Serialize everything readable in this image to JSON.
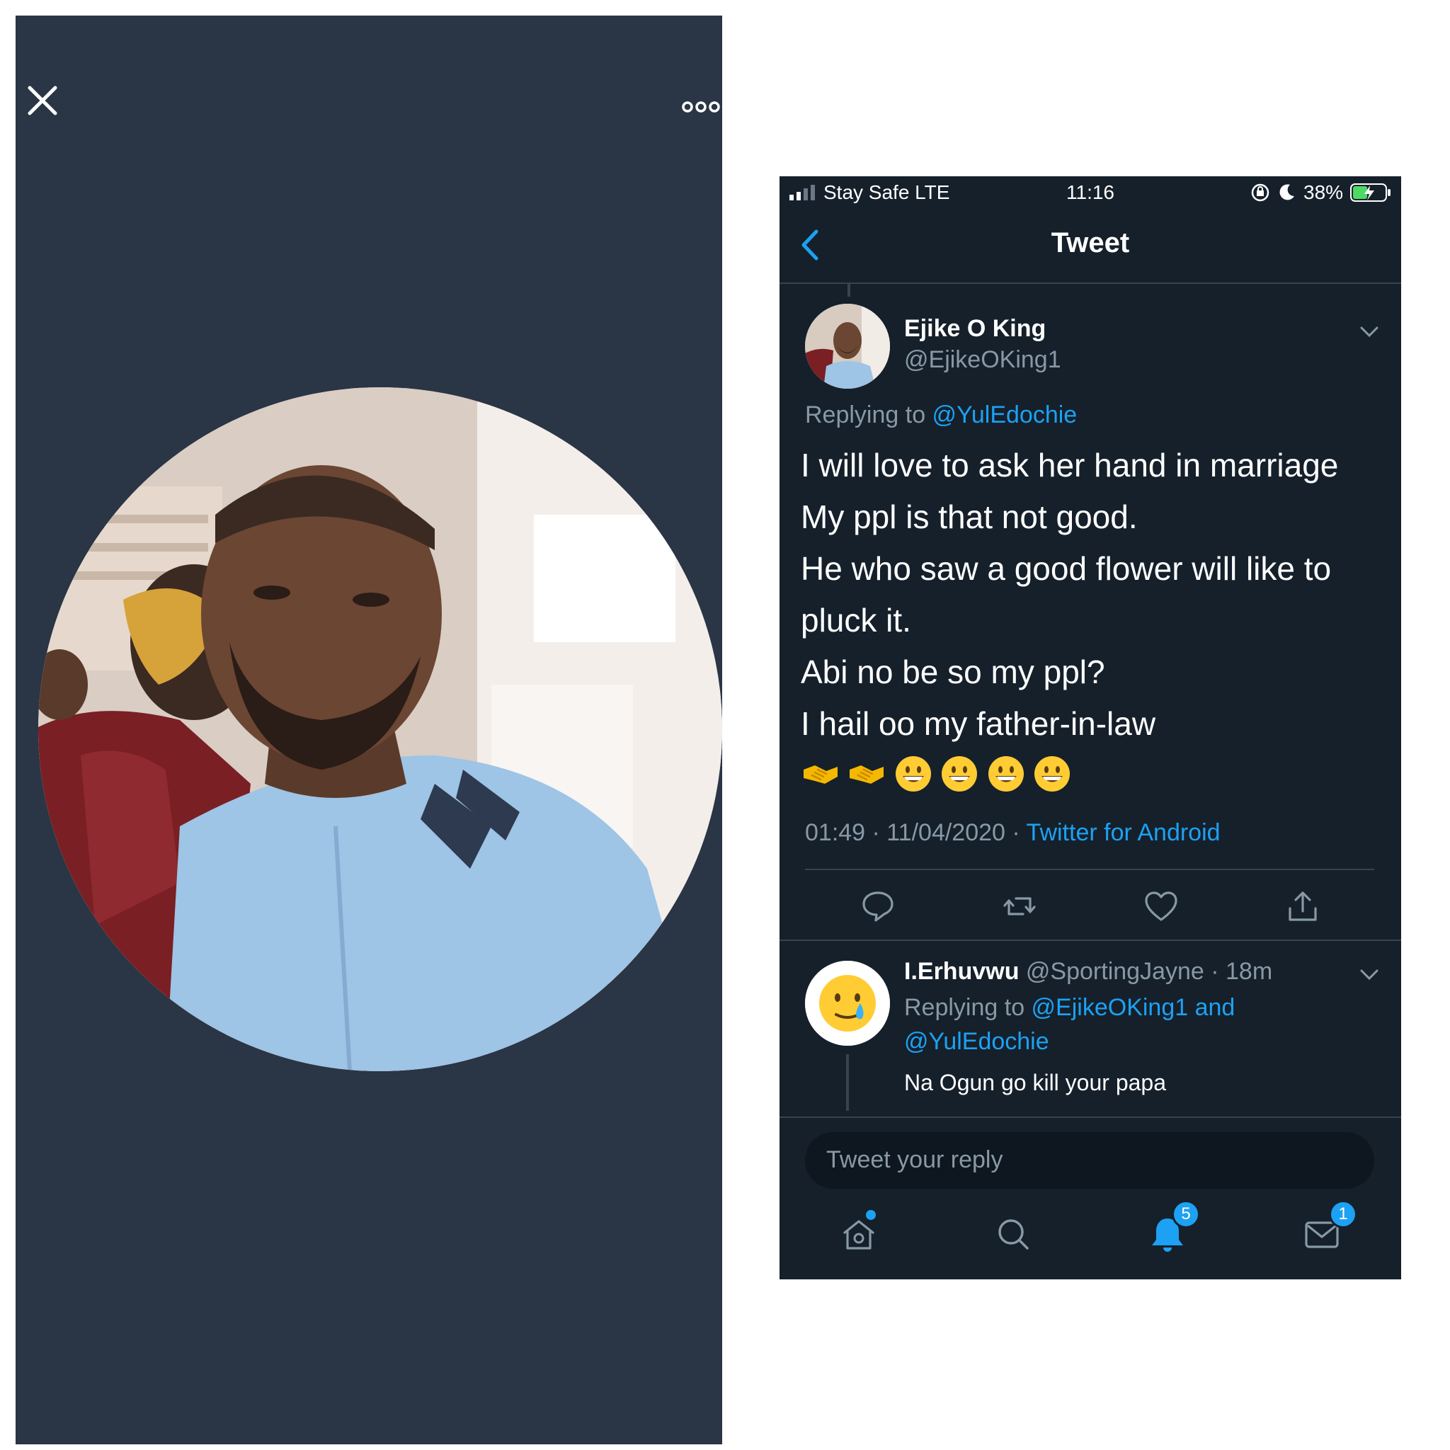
{
  "status_bar": {
    "carrier": "Stay Safe  LTE",
    "time": "11:16",
    "battery": "38%"
  },
  "nav": {
    "title": "Tweet"
  },
  "tweet": {
    "author_name": "Ejike O King",
    "author_handle": "@EjikeOKing1",
    "replying_prefix": "Replying to ",
    "replying_to": "@YulEdochie",
    "lines": [
      "I will love to ask her hand in marriage",
      "My ppl is that not good.",
      "He who saw a good flower will like to",
      "pluck it.",
      "Abi no be so my ppl?",
      "I hail oo my father-in-law"
    ],
    "emojis": [
      "handshake",
      "handshake",
      "grinning-face",
      "grinning-face",
      "grinning-face",
      "grinning-face"
    ],
    "timestamp": "01:49 · 11/04/2020 · ",
    "source": "Twitter for Android"
  },
  "reply": {
    "name": "I.Erhuvwu",
    "handle_time": " @SportingJayne · 18m",
    "replying_prefix": "Replying to ",
    "replying_to_1": "@EjikeOKing1 and",
    "replying_to_2": "@YulEdochie",
    "text": "Na Ogun go kill your papa"
  },
  "composer": {
    "placeholder": "Tweet your reply"
  },
  "tab_bar": {
    "notifications_badge": "5",
    "messages_badge": "1"
  },
  "colors": {
    "viewer_bg": "#2a3545",
    "app_bg": "#15202b",
    "accent": "#1da1f2",
    "secondary_text": "#8899a6",
    "divider": "#38444d"
  }
}
